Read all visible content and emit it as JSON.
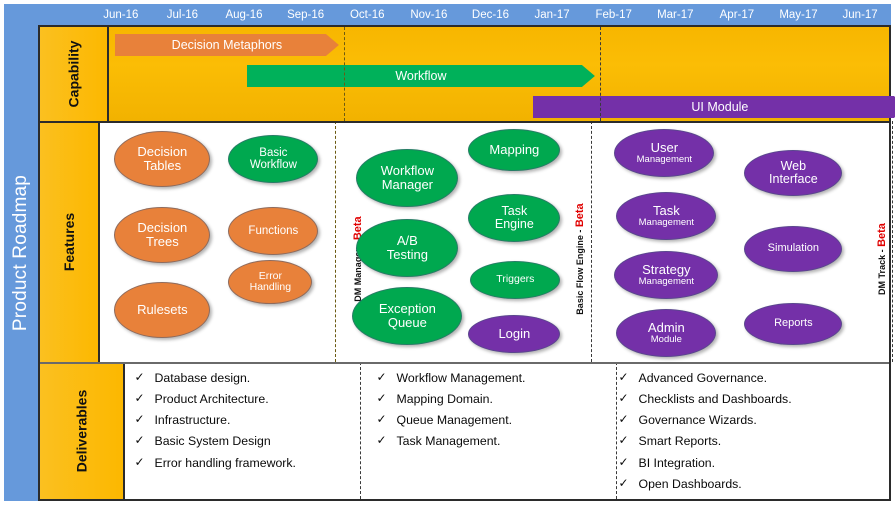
{
  "title": "Product Roadmap",
  "timeline": {
    "months": [
      "Jun-16",
      "Jul-16",
      "Aug-16",
      "Sep-16",
      "Oct-16",
      "Nov-16",
      "Dec-16",
      "Jan-17",
      "Feb-17",
      "Mar-17",
      "Apr-17",
      "May-17",
      "Jun-17"
    ]
  },
  "rows": {
    "capability": {
      "label": "Capability"
    },
    "features": {
      "label": "Features"
    },
    "deliverables": {
      "label": "Deliverables"
    }
  },
  "colors": {
    "brand_blue": "#6699DB",
    "row_gold": "#FBBA00",
    "capability_bg": "#F7B600",
    "orange": "#E8813A",
    "green": "#00B15A",
    "purple": "#7430A8",
    "beta_red": "#E00000"
  },
  "capability_bars": [
    {
      "label": "Decision Metaphors",
      "color": "orange"
    },
    {
      "label": "Workflow",
      "color": "green"
    },
    {
      "label": "UI Module",
      "color": "purple"
    }
  ],
  "milestones": [
    {
      "label_prefix": "DM Manager - ",
      "label_beta": "Beta"
    },
    {
      "label_prefix": "Basic Flow Engine - ",
      "label_beta": "Beta"
    },
    {
      "label_prefix": "DM Track - ",
      "label_beta": "Beta"
    }
  ],
  "features": {
    "group1": [
      {
        "l1": "Decision",
        "l2": "Tables",
        "color": "orange"
      },
      {
        "l1": "Decision",
        "l2": "Trees",
        "color": "orange"
      },
      {
        "l1": "Rulesets",
        "l2": "",
        "color": "orange"
      },
      {
        "l1": "Basic",
        "l2": "Workflow",
        "color": "green"
      },
      {
        "l1": "Functions",
        "l2": "",
        "color": "orange"
      },
      {
        "l1": "Error",
        "l2": "Handling",
        "color": "orange"
      }
    ],
    "group2": [
      {
        "l1": "Workflow",
        "l2": "Manager",
        "color": "green"
      },
      {
        "l1": "A/B",
        "l2": "Testing",
        "color": "green"
      },
      {
        "l1": "Exception",
        "l2": "Queue",
        "color": "green"
      },
      {
        "l1": "Mapping",
        "l2": "",
        "color": "green"
      },
      {
        "l1": "Task",
        "l2": "Engine",
        "color": "green"
      },
      {
        "l1": "Triggers",
        "l2": "",
        "color": "green"
      },
      {
        "l1": "Login",
        "l2": "",
        "color": "purple"
      }
    ],
    "group3": [
      {
        "l1": "User",
        "l2": "Management",
        "color": "purple"
      },
      {
        "l1": "Task",
        "l2": "Management",
        "color": "purple"
      },
      {
        "l1": "Strategy",
        "l2": "Management",
        "color": "purple"
      },
      {
        "l1": "Admin",
        "l2": "Module",
        "color": "purple"
      },
      {
        "l1": "Web",
        "l2": "Interface",
        "color": "purple"
      },
      {
        "l1": "Simulation",
        "l2": "",
        "color": "purple"
      },
      {
        "l1": "Reports",
        "l2": "",
        "color": "purple"
      }
    ]
  },
  "deliverables": {
    "check_icon": "✓",
    "column1": [
      "Database design.",
      "Product Architecture.",
      "Infrastructure.",
      "Basic System Design",
      "Error handling framework."
    ],
    "column2": [
      "Workflow Management.",
      "Mapping Domain.",
      "Queue Management.",
      "Task Management."
    ],
    "column3": [
      "Advanced Governance.",
      "Checklists and Dashboards.",
      "Governance Wizards.",
      "Smart Reports.",
      "BI Integration.",
      "Open Dashboards."
    ]
  }
}
